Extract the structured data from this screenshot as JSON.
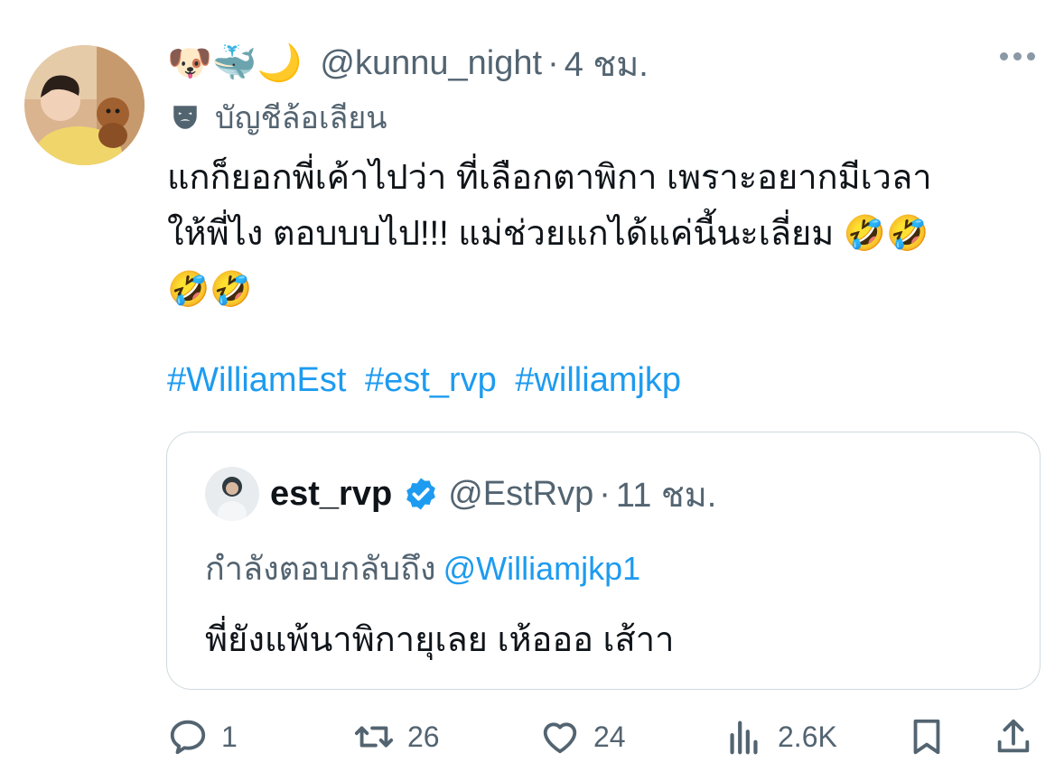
{
  "author": {
    "emoji_name": "🐶🐳🌙",
    "handle": "@kunnu_night",
    "separator": "·",
    "time": "4 ชม.",
    "parody_label": "บัญชีล้อเลียน"
  },
  "body": {
    "line1": "แกก็ยอกพี่เค้าไปว่า ที่เลือกตาพิกา เพราะอยากมีเวลา",
    "line2": "ให้พี่ไง ตอบบบไป!!! แม่ช่วยแกได้แค่นี้นะเลี่ยม 🤣🤣",
    "line3": "🤣🤣"
  },
  "hashtags": [
    "#WilliamEst",
    "#est_rvp",
    "#williamjkp"
  ],
  "quote": {
    "name": "est_rvp",
    "handle": "@EstRvp",
    "separator": "·",
    "time": "11 ชม.",
    "replying_prefix": "กำลังตอบกลับถึง",
    "replying_to": "@Williamjkp1",
    "text": "พี่ยังแพ้นาพิกายุเลย เห้อออ เส้าา"
  },
  "actions": {
    "reply_count": "1",
    "repost_count": "26",
    "like_count": "24",
    "views_count": "2.6K"
  },
  "icons": {
    "more": "more-icon",
    "parody": "theater-mask-icon",
    "verified": "verified-badge-icon",
    "reply": "reply-icon",
    "repost": "repost-icon",
    "like": "heart-icon",
    "views": "views-icon",
    "bookmark": "bookmark-icon",
    "share": "share-icon"
  },
  "colors": {
    "accent": "#1d9bf0",
    "secondary_text": "#536471",
    "border": "#cfd9de"
  }
}
